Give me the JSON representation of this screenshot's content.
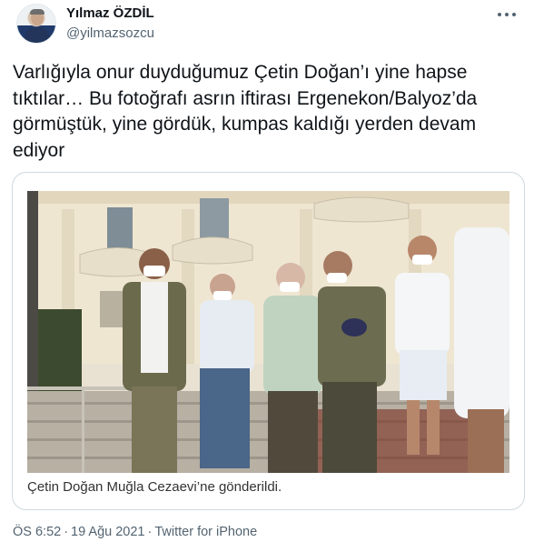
{
  "author": {
    "display_name": "Yılmaz ÖZDİL",
    "handle": "@yilmazsozcu"
  },
  "tweet": {
    "text": "Varlığıyla onur duyduğumuz Çetin Doğan’ı yine hapse\ntıktılar… Bu fotoğrafı asrın iftirası Ergenekon/Balyoz’da\ngörmüştük, yine gördük, kumpas kaldığı yerden devam\nediyor"
  },
  "media": {
    "caption": "Çetin Doğan Muğla Cezaevi’ne gönderildi."
  },
  "meta": {
    "time": "ÖS 6:52",
    "date": "19 Ağu 2021",
    "source": "Twitter for iPhone",
    "separator": "·"
  },
  "colors": {
    "text": "#0f1419",
    "secondary": "#536471",
    "border": "#cfd9de"
  },
  "icons": [
    "more-icon"
  ]
}
